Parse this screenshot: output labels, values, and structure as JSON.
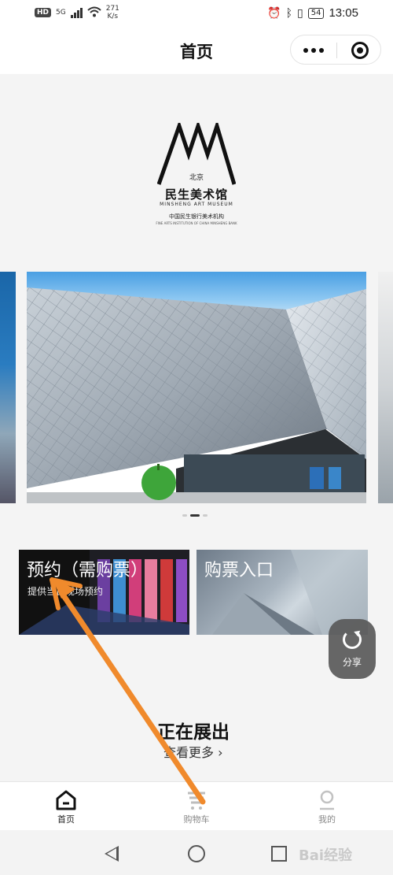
{
  "status_bar": {
    "network_badge": "HD",
    "signal_type": "5G",
    "speed_value": "271",
    "speed_unit": "K/s",
    "battery": "54",
    "time": "13:05"
  },
  "nav": {
    "title": "首页"
  },
  "logo": {
    "city": "北京",
    "name_cn": "民生美术馆",
    "name_en": "MINSHENG ART MUSEUM",
    "parent_cn": "中国民生银行美术机构",
    "parent_en": "FINE ARTS INSTITUTION OF CHINA MINSHENG BANK"
  },
  "carousel": {
    "slide_count": 3,
    "active_index": 1
  },
  "tiles": {
    "reserve_title": "预约（需购票）",
    "reserve_subtitle": "提供当日现场预约",
    "ticket_title": "购票入口"
  },
  "share": {
    "label": "分享"
  },
  "exhibition": {
    "title": "正在展出",
    "more": "查看更多",
    "more_chevron": "›"
  },
  "tabbar": {
    "items": [
      {
        "label": "首页",
        "icon": "home-icon",
        "active": true
      },
      {
        "label": "购物车",
        "icon": "cart-icon",
        "active": false
      },
      {
        "label": "我的",
        "icon": "profile-icon",
        "active": false
      }
    ]
  },
  "watermark": "Bai经验",
  "colors": {
    "annotation_arrow": "#f08a2c",
    "page_background": "#f4f4f4",
    "share_button": "#5a5a5a"
  }
}
